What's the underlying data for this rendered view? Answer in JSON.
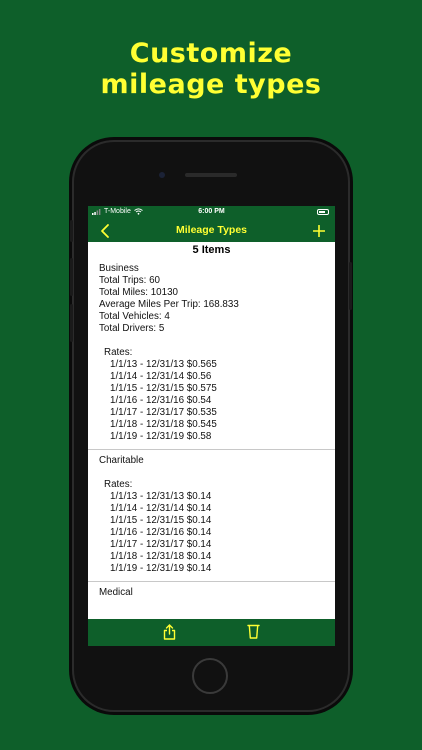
{
  "headline": {
    "line1": "Customize",
    "line2": "mileage types"
  },
  "status_bar": {
    "carrier": "T-Mobile",
    "time": "6:00 PM"
  },
  "navbar": {
    "back_icon": "chevron-left-icon",
    "title": "Mileage Types",
    "add_icon": "plus-icon"
  },
  "items_count": "5 Items",
  "sections": [
    {
      "name": "Business",
      "stats": [
        "Total Trips: 60",
        "Total Miles: 10130",
        "Average Miles Per Trip: 168.833",
        "Total Vehicles: 4",
        "Total Drivers: 5"
      ],
      "rates_label": "Rates:",
      "rates": [
        "1/1/13 - 12/31/13 $0.565",
        "1/1/14 - 12/31/14 $0.56",
        "1/1/15 - 12/31/15 $0.575",
        "1/1/16 - 12/31/16 $0.54",
        "1/1/17 - 12/31/17 $0.535",
        "1/1/18 - 12/31/18 $0.545",
        "1/1/19 - 12/31/19 $0.58"
      ]
    },
    {
      "name": "Charitable",
      "stats": [],
      "rates_label": "Rates:",
      "rates": [
        "1/1/13 - 12/31/13 $0.14",
        "1/1/14 - 12/31/14 $0.14",
        "1/1/15 - 12/31/15 $0.14",
        "1/1/16 - 12/31/16 $0.14",
        "1/1/17 - 12/31/17 $0.14",
        "1/1/18 - 12/31/18 $0.14",
        "1/1/19 - 12/31/19 $0.14"
      ]
    },
    {
      "name": "Medical",
      "stats": [],
      "rates_label": "",
      "rates": []
    }
  ],
  "tabbar": {
    "share_icon": "share-icon",
    "delete_icon": "trash-icon"
  },
  "colors": {
    "background": "#0e5f2a",
    "accent": "#ffff33",
    "screen": "#ffffff"
  }
}
